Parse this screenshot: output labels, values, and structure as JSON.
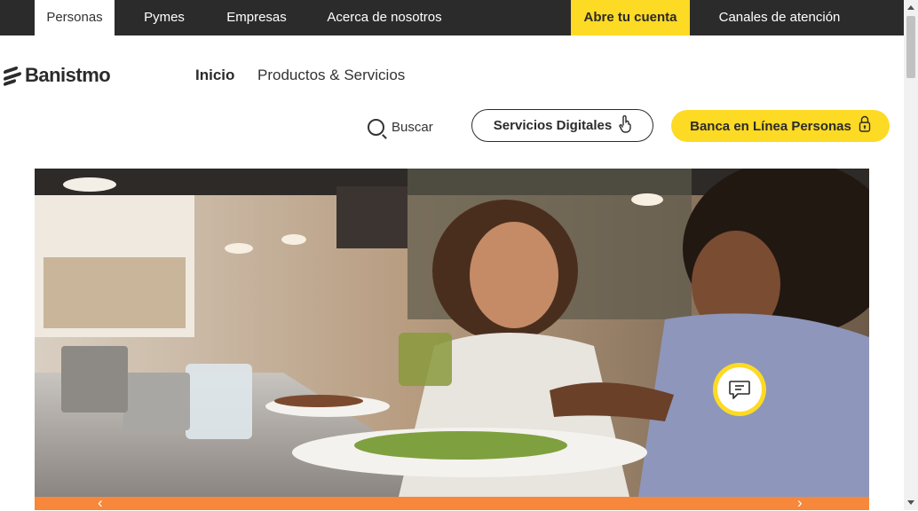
{
  "topbar": {
    "tabs": [
      {
        "label": "Personas",
        "active": true
      },
      {
        "label": "Pymes"
      },
      {
        "label": "Empresas"
      },
      {
        "label": "Acerca de nosotros"
      }
    ],
    "cta_label": "Abre tu cuenta",
    "channels_label": "Canales de atención"
  },
  "header": {
    "logo_text": "Banistmo",
    "nav": [
      {
        "label": "Inicio"
      },
      {
        "label": "Productos & Servicios"
      }
    ],
    "search_label": "Buscar",
    "digital_services_label": "Servicios Digitales",
    "online_banking_label": "Banca en Línea Personas"
  },
  "hero": {
    "prev_arrow": "‹",
    "next_arrow": "›"
  },
  "colors": {
    "brand_yellow": "#fdda24",
    "dark": "#2b2b2b",
    "orange": "#f7873a"
  },
  "icons": {
    "search": "search-icon",
    "hand": "touch-hand-icon",
    "lock": "lock-icon",
    "chat": "chat-icon"
  }
}
